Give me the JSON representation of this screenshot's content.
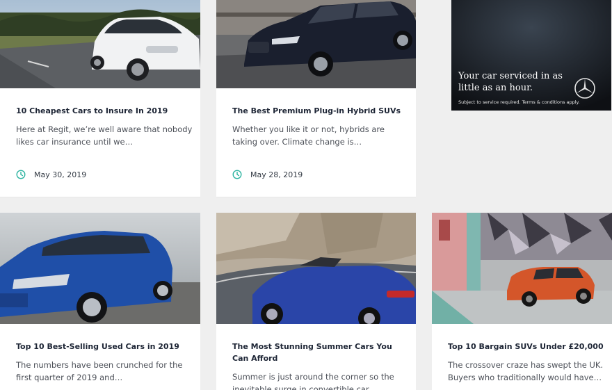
{
  "articles": [
    {
      "title": "10 Cheapest Cars to Insure In 2019",
      "excerpt": "Here at Regit, we’re well aware that nobody likes car insurance until we…",
      "date": "May 30, 2019"
    },
    {
      "title": "The Best Premium Plug-in Hybrid SUVs",
      "excerpt": "Whether you like it or not, hybrids are taking over. Climate change is…",
      "date": "May 28, 2019"
    },
    {
      "title": "Top 10 Best-Selling Used Cars in 2019",
      "excerpt": "The numbers have been crunched for the first quarter of 2019 and…"
    },
    {
      "title": "The Most Stunning Summer Cars You Can Afford",
      "excerpt": "Summer is just around the corner so the inevitable surge in convertible car…"
    },
    {
      "title": "Top 10 Bargain SUVs Under £20,000",
      "excerpt": "The crossover craze has swept the UK. Buyers who traditionally would have…"
    }
  ],
  "ad": {
    "headline": "Your car serviced in as little as an hour.",
    "small_print": "Subject to service required. Terms & conditions apply.",
    "logo_icon": "three-pointed-star-logo"
  },
  "icons": {
    "date": "clock-icon"
  },
  "colors": {
    "accent": "#2bb3a0",
    "title": "#1d2535",
    "text": "#4b4f57",
    "background": "#efefef"
  }
}
